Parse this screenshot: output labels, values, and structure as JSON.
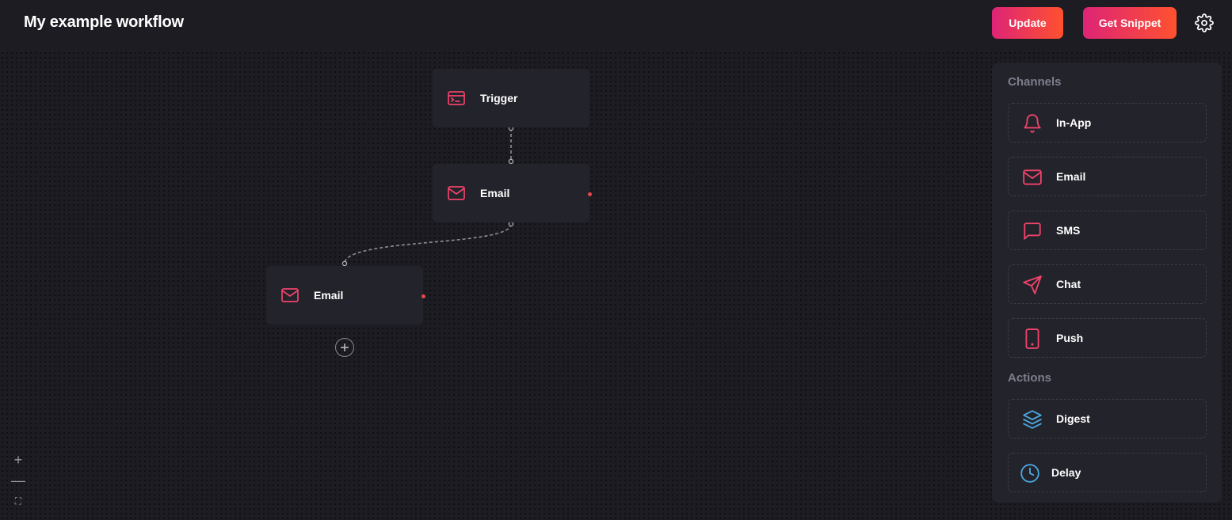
{
  "header": {
    "title": "My example workflow",
    "update_label": "Update",
    "snippet_label": "Get Snippet"
  },
  "nodes": [
    {
      "label": "Trigger",
      "icon": "terminal-icon"
    },
    {
      "label": "Email",
      "icon": "mail-icon"
    },
    {
      "label": "Email",
      "icon": "mail-icon"
    }
  ],
  "zoom_controls": {
    "zoom_in": "+",
    "zoom_out": "—",
    "fit_view": "⛶"
  },
  "sidebar": {
    "channels_title": "Channels",
    "channels": [
      {
        "label": "In-App",
        "icon": "bell-icon"
      },
      {
        "label": "Email",
        "icon": "mail-icon"
      },
      {
        "label": "SMS",
        "icon": "message-icon"
      },
      {
        "label": "Chat",
        "icon": "send-icon"
      },
      {
        "label": "Push",
        "icon": "mobile-icon"
      }
    ],
    "actions_title": "Actions",
    "actions": [
      {
        "label": "Digest",
        "icon": "layers-icon"
      },
      {
        "label": "Delay",
        "icon": "clock-icon"
      }
    ]
  },
  "colors": {
    "background": "#1c1c22",
    "card": "#23232b",
    "accent_gradient_start": "#dd2476",
    "accent_gradient_end": "#ff512f",
    "action_icon": "#4aa8e0",
    "node_handle": "#e8484c"
  }
}
